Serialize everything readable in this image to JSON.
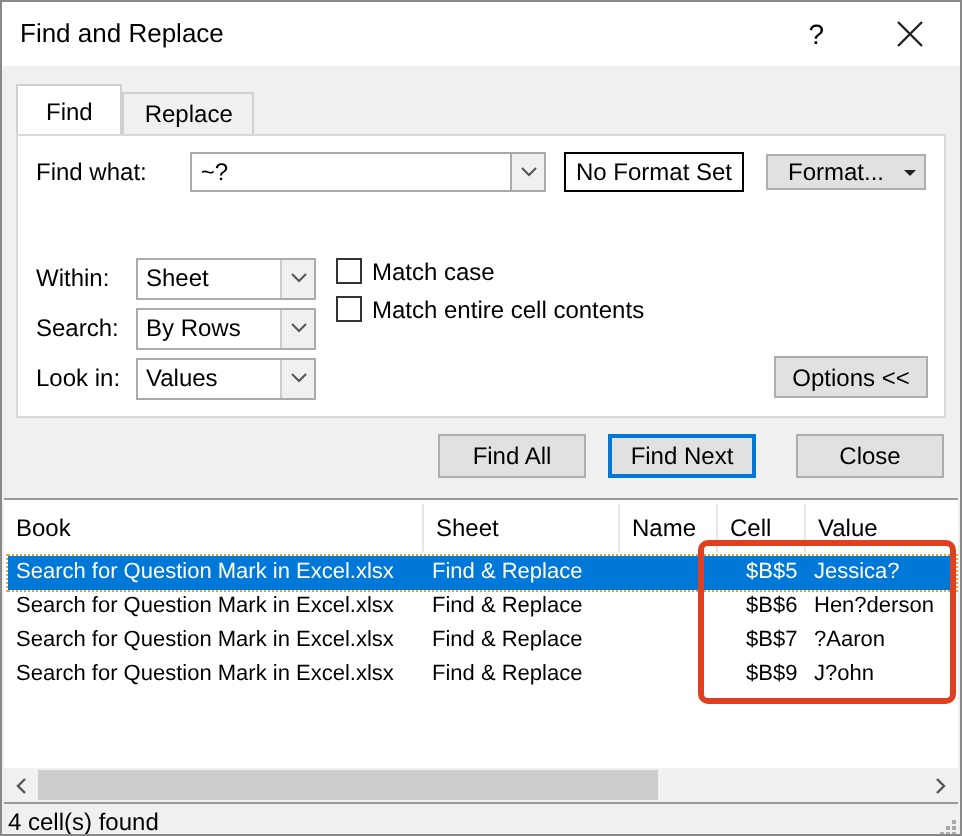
{
  "window": {
    "title": "Find and Replace",
    "help": "?"
  },
  "tabs": [
    {
      "label": "Find",
      "selected": true
    },
    {
      "label": "Replace",
      "selected": false
    }
  ],
  "find_what": {
    "label": "Find what:",
    "value": "~?"
  },
  "format_status": "No Format Set",
  "format_button": "Format...",
  "options": [
    {
      "label": "Within:",
      "value": "Sheet"
    },
    {
      "label": "Search:",
      "value": "By Rows"
    },
    {
      "label": "Look in:",
      "value": "Values"
    }
  ],
  "checkboxes": [
    {
      "label": "Match case",
      "checked": false
    },
    {
      "label": "Match entire cell contents",
      "checked": false
    }
  ],
  "options_button": "Options <<",
  "buttons": [
    {
      "label": "Find All",
      "default": false
    },
    {
      "label": "Find Next",
      "default": true
    },
    {
      "label": "Close",
      "default": false
    }
  ],
  "results": {
    "columns": [
      "Book",
      "Sheet",
      "Name",
      "Cell",
      "Value"
    ],
    "rows": [
      {
        "cells": [
          "Search for Question Mark in Excel.xlsx",
          "Find & Replace",
          "",
          "$B$5",
          "Jessica?"
        ],
        "selected": true
      },
      {
        "cells": [
          "Search for Question Mark in Excel.xlsx",
          "Find & Replace",
          "",
          "$B$6",
          "Hen?derson"
        ],
        "selected": false
      },
      {
        "cells": [
          "Search for Question Mark in Excel.xlsx",
          "Find & Replace",
          "",
          "$B$7",
          "?Aaron"
        ],
        "selected": false
      },
      {
        "cells": [
          "Search for Question Mark in Excel.xlsx",
          "Find & Replace",
          "",
          "$B$9",
          "J?ohn"
        ],
        "selected": false
      }
    ]
  },
  "status_bar": "4 cell(s) found"
}
